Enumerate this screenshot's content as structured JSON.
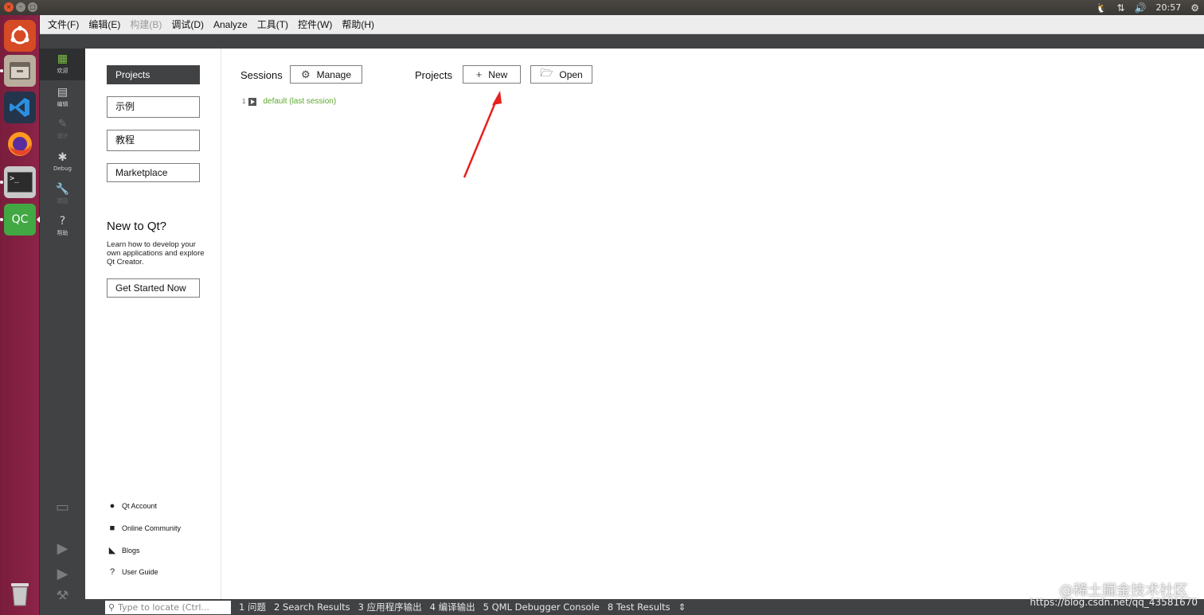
{
  "system": {
    "clock": "20:57",
    "tray_icons": [
      "penguin-icon",
      "network-icon",
      "volume-icon",
      "settings-gear-icon"
    ]
  },
  "launcher": {
    "apps": [
      {
        "name": "ubuntu-dash",
        "glyph": "◉",
        "color": "#d64a25"
      },
      {
        "name": "files",
        "glyph": "▭",
        "color": "#9a8a78"
      },
      {
        "name": "vscode",
        "glyph": "❮❯",
        "color": "#1e76c8"
      },
      {
        "name": "firefox",
        "glyph": "●",
        "color": "#e8632a"
      },
      {
        "name": "terminal",
        "glyph": ">_",
        "color": "#2b2b2b"
      },
      {
        "name": "qt-creator",
        "glyph": "QC",
        "color": "#41a843"
      }
    ],
    "trash_glyph": "🗑"
  },
  "menubar": {
    "items": [
      {
        "label": "文件(F)",
        "enabled": true
      },
      {
        "label": "编辑(E)",
        "enabled": true
      },
      {
        "label": "构建(B)",
        "enabled": false
      },
      {
        "label": "调试(D)",
        "enabled": true
      },
      {
        "label": "Analyze",
        "enabled": true
      },
      {
        "label": "工具(T)",
        "enabled": true
      },
      {
        "label": "控件(W)",
        "enabled": true
      },
      {
        "label": "帮助(H)",
        "enabled": true
      }
    ]
  },
  "modes": {
    "welcome": "欢迎",
    "edit": "编辑",
    "design": "设计",
    "debug": "Debug",
    "projects": "项目",
    "help": "帮助"
  },
  "left_pane": {
    "projects_btn": "Projects",
    "examples_btn": "示例",
    "tutorials_btn": "教程",
    "marketplace_btn": "Marketplace",
    "new_to_qt_title": "New to Qt?",
    "new_to_qt_text": "Learn how to develop your own applications and explore Qt Creator.",
    "get_started_btn": "Get Started Now",
    "links": {
      "qt_account": "Qt Account",
      "online_community": "Online Community",
      "blogs": "Blogs",
      "user_guide": "User Guide"
    }
  },
  "main": {
    "sessions_header": "Sessions",
    "manage_btn": "Manage",
    "projects_header": "Projects",
    "new_btn": "New",
    "open_btn": "Open",
    "session_index": "1",
    "session_name": "default (last session)"
  },
  "statusbar": {
    "locator_placeholder": "Type to locate (Ctrl...",
    "tabs": {
      "t1": "1  问题",
      "t2": "2  Search Results",
      "t3": "3  应用程序输出",
      "t4": "4  编译输出",
      "t5": "5  QML Debugger Console",
      "t8": "8  Test Results"
    }
  },
  "watermark": {
    "text": "@稀土掘金技术社区",
    "url": "https://blog.csdn.net/qq_43581670"
  },
  "colors": {
    "launcher_bg": "#8c2447",
    "mode_bar": "#404244",
    "session_link": "#5daa2e",
    "arrow": "#e8201e"
  }
}
